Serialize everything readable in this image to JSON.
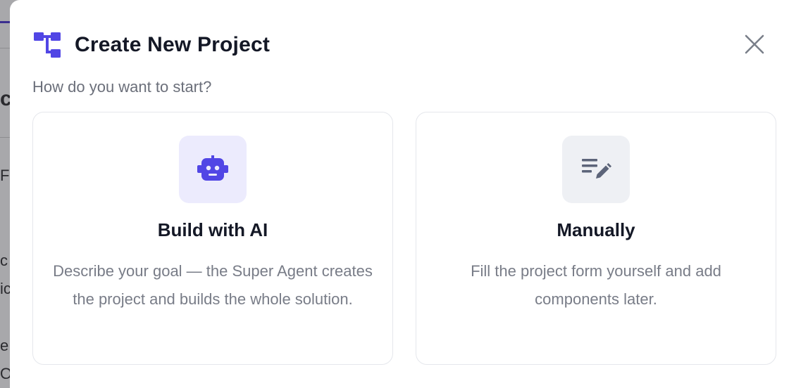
{
  "modal": {
    "title": "Create New Project",
    "header_icon": "project-hierarchy-icon",
    "close_icon": "close-icon",
    "subtitle": "How do you want to start?"
  },
  "options": [
    {
      "id": "ai",
      "icon": "robot-icon",
      "title": "Build with AI",
      "description": "Describe your goal — the Super Agent creates the project and builds the whole solution."
    },
    {
      "id": "manual",
      "icon": "edit-notes-icon",
      "title": "Manually",
      "description": "Fill the project form yourself and add components later."
    }
  ],
  "background_fragments": [
    "ct",
    "F",
    "c",
    "ic",
    "e",
    "Op"
  ],
  "colors": {
    "accent": "#5146e5",
    "ai_tile": "#ecebfd",
    "manual_tile": "#eef0f4",
    "manual_icon": "#5c6479",
    "title_text": "#141826",
    "muted_text": "#787c87"
  }
}
